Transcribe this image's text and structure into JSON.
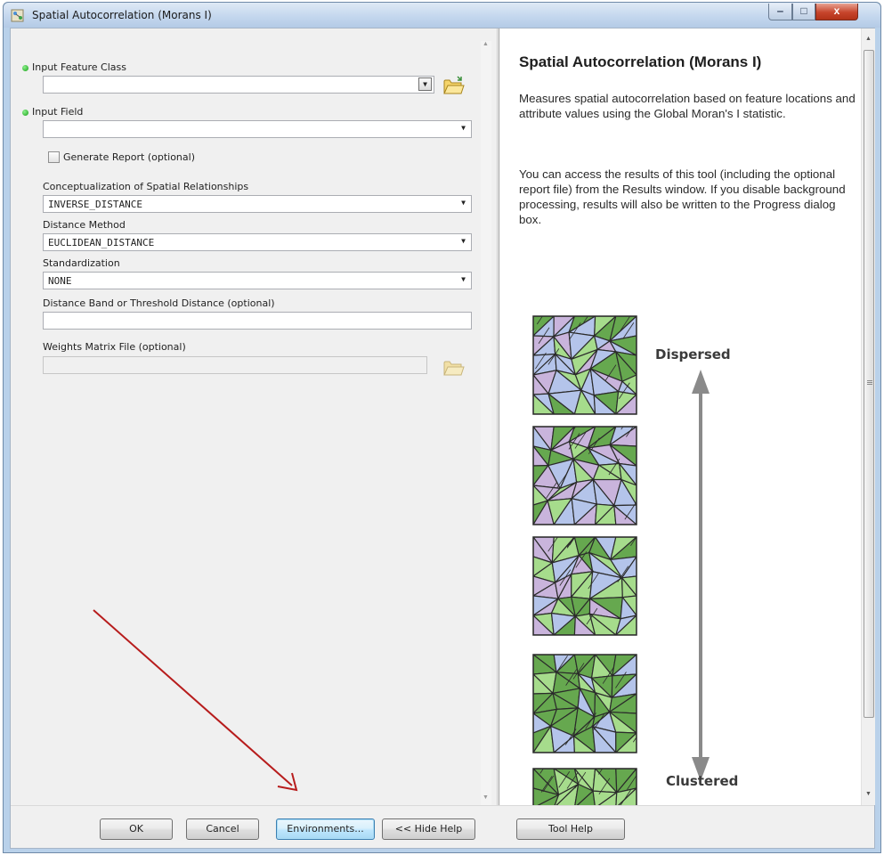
{
  "window": {
    "title": "Spatial Autocorrelation (Morans I)",
    "controls": {
      "minimize": "‒",
      "maximize": "□",
      "close": "x"
    }
  },
  "form": {
    "input_feature_class": {
      "label": "Input Feature Class",
      "value": ""
    },
    "input_field": {
      "label": "Input Field",
      "value": ""
    },
    "generate_report": {
      "label": "Generate Report (optional)",
      "checked": false
    },
    "conceptualization": {
      "label": "Conceptualization of Spatial Relationships",
      "value": "INVERSE_DISTANCE"
    },
    "distance_method": {
      "label": "Distance Method",
      "value": "EUCLIDEAN_DISTANCE"
    },
    "standardization": {
      "label": "Standardization",
      "value": "NONE"
    },
    "distance_band": {
      "label": "Distance Band or Threshold Distance (optional)",
      "value": ""
    },
    "weights_matrix": {
      "label": "Weights Matrix File (optional)",
      "value": ""
    }
  },
  "help": {
    "title": "Spatial Autocorrelation (Morans I)",
    "para1": "Measures spatial autocorrelation based on feature locations and attribute values using the Global Moran's I statistic.",
    "para2": "You can access the results of this tool (including the optional report file) from the Results window. If you disable background processing, results will also be written to the Progress dialog box.",
    "diagram": {
      "top_label": "Dispersed",
      "bottom_label": "Clustered"
    }
  },
  "buttons": {
    "ok": "OK",
    "cancel": "Cancel",
    "environments": "Environments...",
    "hide_help": "<< Hide Help",
    "tool_help": "Tool Help"
  },
  "colors": {
    "patch_green_light": "#a6dc8c",
    "patch_green_dark": "#66a84f",
    "patch_blue": "#b4c4ea",
    "patch_purple": "#c9b4dc",
    "annotation_arrow": "#b71c1c"
  }
}
